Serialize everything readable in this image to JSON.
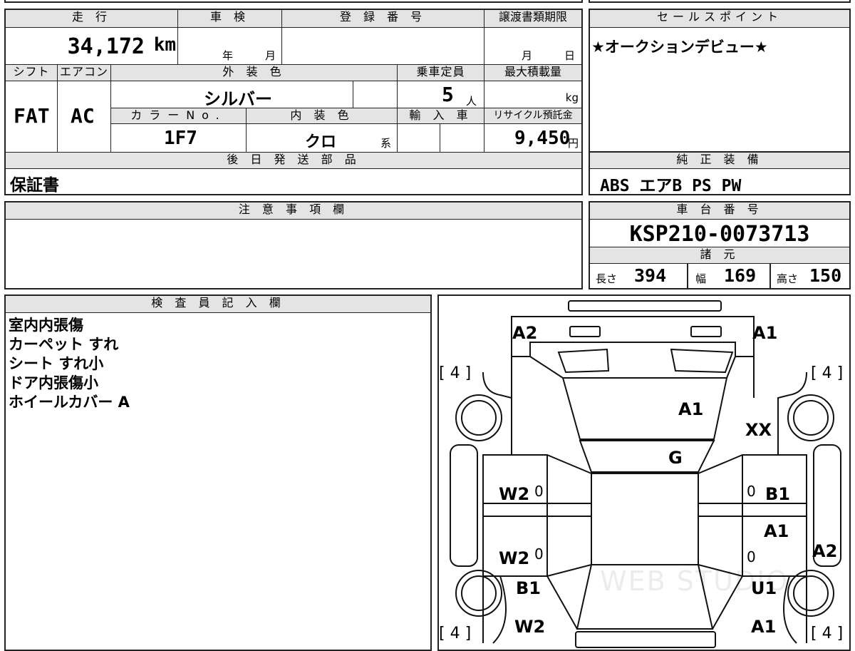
{
  "headers": {
    "mileage": "走 行",
    "inspection": "車 検",
    "registration_no": "登 録 番 号",
    "transfer_deadline": "譲渡書類期限",
    "sales_point": "セールスポイント",
    "shift": "シフト",
    "aircon": "エアコン",
    "exterior_color": "外 装 色",
    "capacity": "乗車定員",
    "max_load": "最大積載量",
    "color_no": "カラーNo.",
    "interior_color": "内 装 色",
    "import": "輸 入 車",
    "recycle": "リサイクル預託金",
    "later_parts": "後 日 発 送 部 品",
    "genuine_equipment": "純 正 装 備",
    "notes": "注 意 事 項 欄",
    "chassis_no": "車 台 番 号",
    "specs": "諸 元",
    "inspector": "検 査 員 記 入 欄"
  },
  "values": {
    "mileage": "34,172",
    "mileage_unit": "km",
    "year_unit": "年",
    "month_unit": "月",
    "deadline_month": "月",
    "deadline_day": "日",
    "sales_point": "★オークションデビュー★",
    "shift": "FAT",
    "aircon": "AC",
    "exterior_color": "シルバー",
    "capacity": "5",
    "capacity_unit": "人",
    "load_unit": "kg",
    "color_no": "1F7",
    "interior_color": "クロ",
    "interior_suffix": "系",
    "recycle_amount": "9,450",
    "yen": "円",
    "later_parts": "保証書",
    "genuine_equipment": "ABS エアB PS PW",
    "chassis_no": "KSP210-0073713",
    "length_label": "長さ",
    "length": "394",
    "width_label": "幅",
    "width": "169",
    "height_label": "高さ",
    "height": "150"
  },
  "inspector_notes": [
    "室内内張傷",
    "カーペット すれ",
    "シート すれ小",
    "ドア内張傷小",
    "ホイールカバー A"
  ],
  "diagram": {
    "tire_top_left": "[ 4 ]",
    "tire_top_right": "[ 4 ]",
    "tire_bottom_left": "[ 4 ]",
    "tire_bottom_right": "[ 4 ]",
    "rear_left": "A2",
    "rear_right": "A1",
    "roof": "A1",
    "right_rear_fender": "XX",
    "rear_glass": "G",
    "left_rear_door": "W2",
    "left_front_door": "W2",
    "right_rear_door": "B1",
    "right_front_door_upper": "A1",
    "right_front_door_side": "A2",
    "left_front_fender": "B1",
    "right_front_fender": "U1",
    "left_front_corner": "W2",
    "right_front_corner": "A1",
    "zero": "0",
    "watermark": "WEB STUDIO"
  }
}
